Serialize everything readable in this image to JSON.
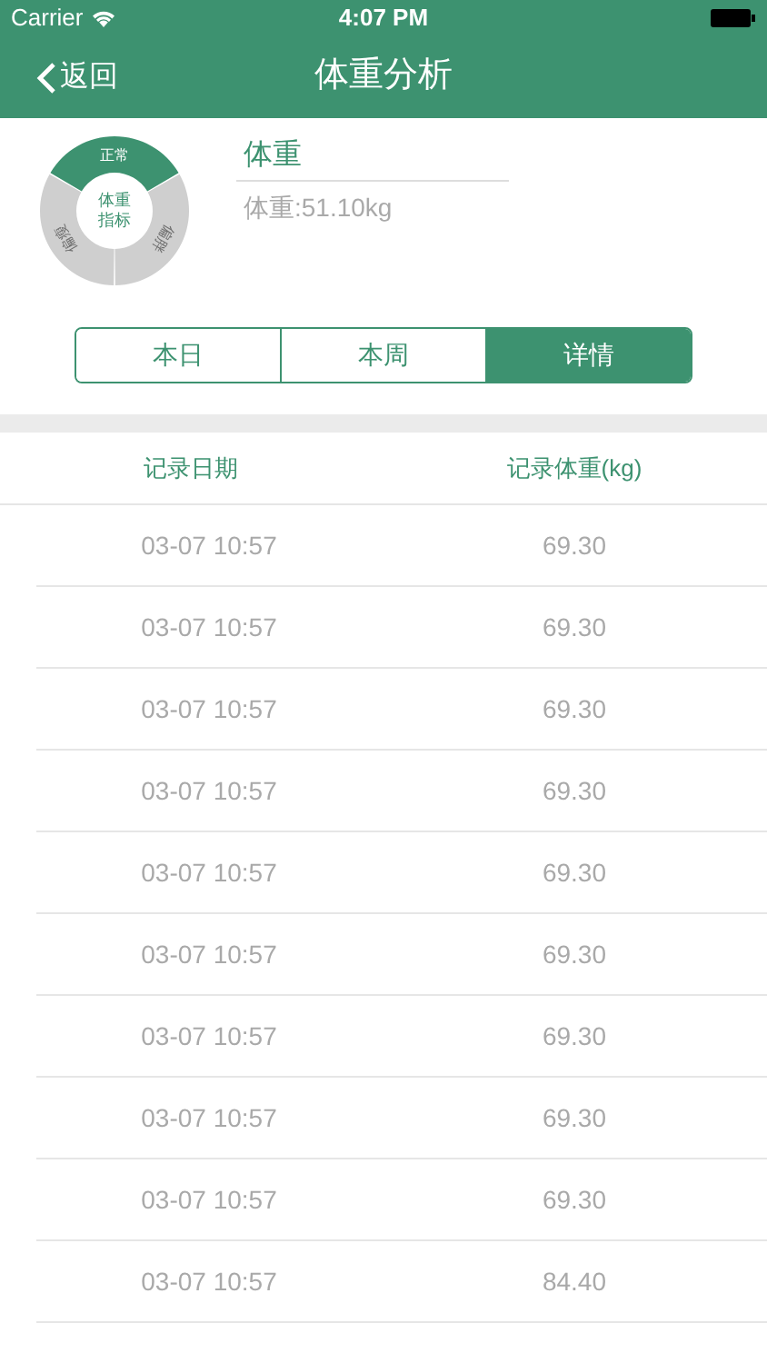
{
  "status_bar": {
    "carrier": "Carrier",
    "time": "4:07 PM"
  },
  "nav": {
    "back": "返回",
    "title": "体重分析"
  },
  "gauge": {
    "center_lines": [
      "体重",
      "指标"
    ],
    "segments": [
      {
        "label": "偏瘦",
        "selected": false
      },
      {
        "label": "正常",
        "selected": true
      },
      {
        "label": "偏胖",
        "selected": false
      }
    ]
  },
  "summary": {
    "title": "体重",
    "value": "体重:51.10kg"
  },
  "tabs": [
    {
      "label": "本日",
      "selected": false
    },
    {
      "label": "本周",
      "selected": false
    },
    {
      "label": "详情",
      "selected": true
    }
  ],
  "table": {
    "columns": [
      "记录日期",
      "记录体重(kg)"
    ],
    "rows": [
      [
        "03-07 10:57",
        "69.30"
      ],
      [
        "03-07 10:57",
        "69.30"
      ],
      [
        "03-07 10:57",
        "69.30"
      ],
      [
        "03-07 10:57",
        "69.30"
      ],
      [
        "03-07 10:57",
        "69.30"
      ],
      [
        "03-07 10:57",
        "69.30"
      ],
      [
        "03-07 10:57",
        "69.30"
      ],
      [
        "03-07 10:57",
        "69.30"
      ],
      [
        "03-07 10:57",
        "69.30"
      ],
      [
        "03-07 10:57",
        "84.40"
      ]
    ]
  }
}
